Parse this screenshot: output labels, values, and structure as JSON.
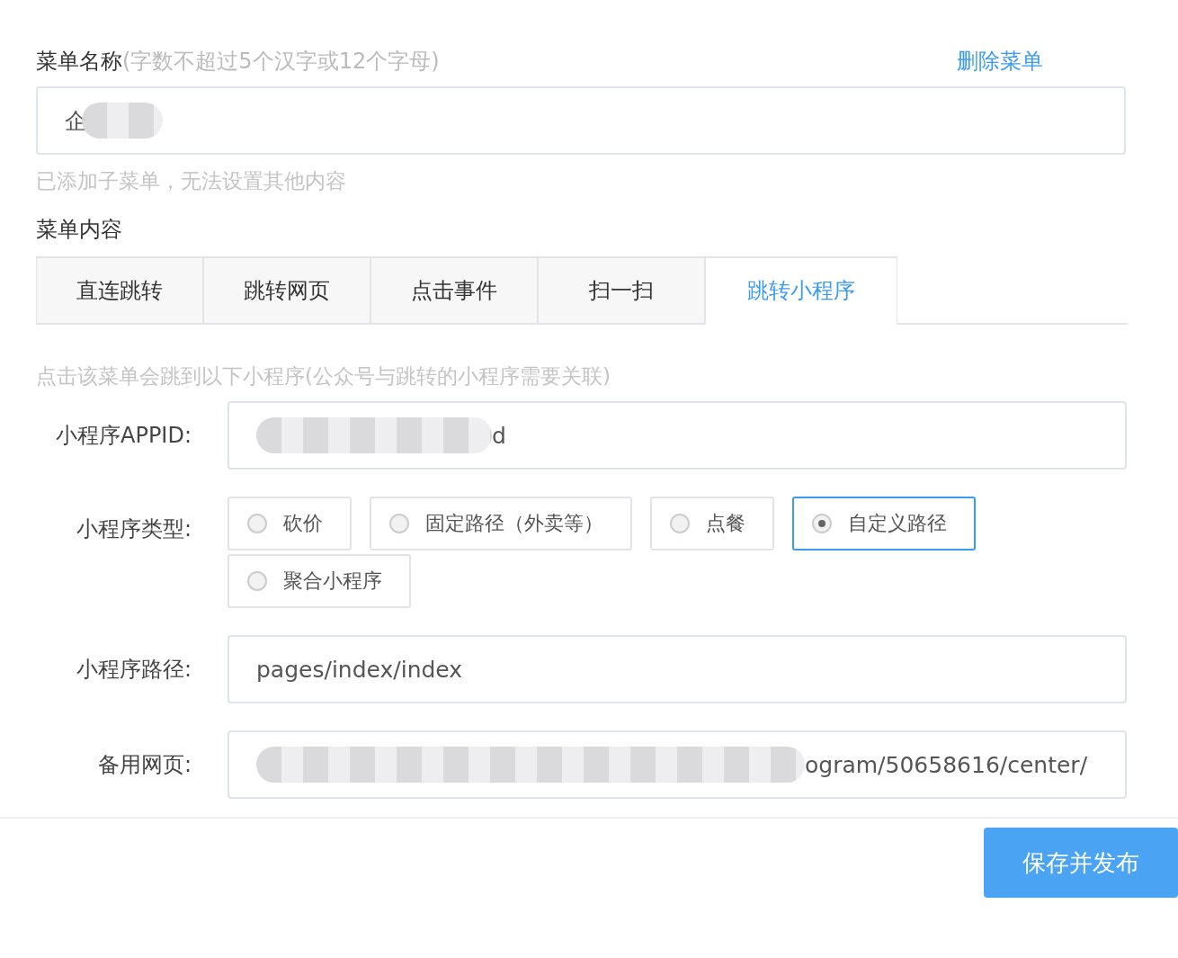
{
  "menu_name": {
    "label": "菜单名称",
    "hint": "(字数不超过5个汉字或12个字母)",
    "delete_link": "删除菜单",
    "value": "企",
    "redacted": true,
    "note": "已添加子菜单，无法设置其他内容"
  },
  "menu_content": {
    "label": "菜单内容",
    "tabs": [
      {
        "label": "直连跳转",
        "selected": false
      },
      {
        "label": "跳转网页",
        "selected": false
      },
      {
        "label": "点击事件",
        "selected": false
      },
      {
        "label": "扫一扫",
        "selected": false
      },
      {
        "label": "跳转小程序",
        "selected": true
      }
    ]
  },
  "mini_program": {
    "hint": "点击该菜单会跳到以下小程序(公众号与跳转的小程序需要关联)",
    "appid": {
      "label": "小程序APPID:",
      "value": "d",
      "redacted": true
    },
    "type": {
      "label": "小程序类型:",
      "options": [
        {
          "label": "砍价",
          "selected": false
        },
        {
          "label": "固定路径（外卖等）",
          "selected": false
        },
        {
          "label": "点餐",
          "selected": false
        },
        {
          "label": "自定义路径",
          "selected": true
        },
        {
          "label": "聚合小程序",
          "selected": false
        }
      ]
    },
    "path": {
      "label": "小程序路径:",
      "value": "pages/index/index",
      "redacted": false
    },
    "backup_page": {
      "label": "备用网页:",
      "value": "ogram/50658616/center/",
      "redacted": true
    }
  },
  "save_button": "保存并发布"
}
